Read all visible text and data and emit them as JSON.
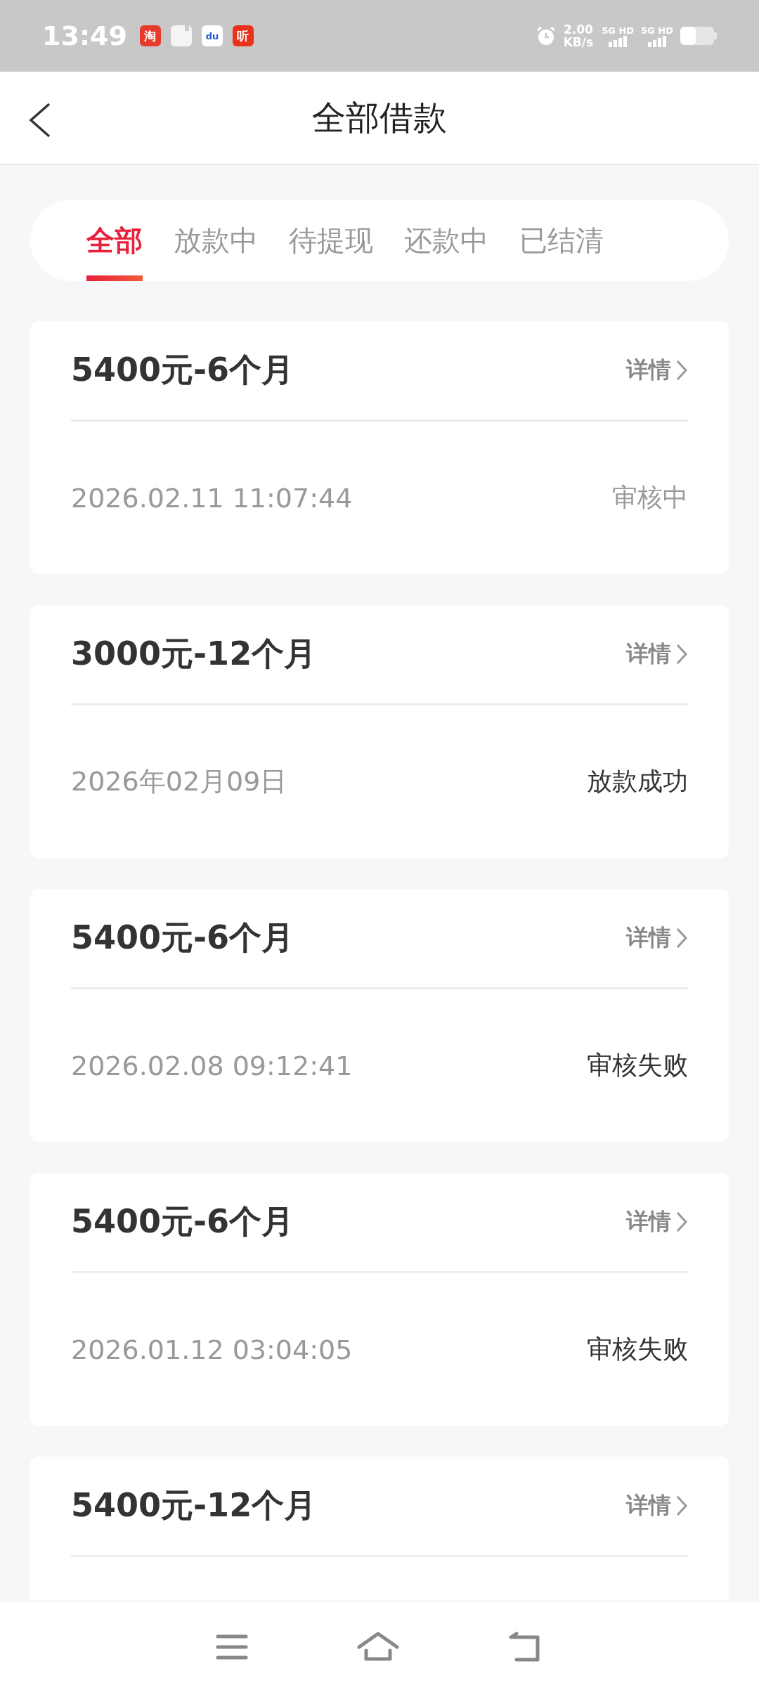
{
  "status_bar": {
    "time": "13:49",
    "speed_value": "2.00",
    "speed_unit": "KB/s",
    "sim_1": "5G HD",
    "sim_2": "5G HD",
    "notification_apps": [
      {
        "kind": "taobao",
        "label": "淘"
      },
      {
        "kind": "cloud"
      },
      {
        "kind": "baidu",
        "label": "du"
      },
      {
        "kind": "listen",
        "label": "听"
      }
    ]
  },
  "header": {
    "title": "全部借款"
  },
  "tabs": [
    {
      "label": "全部",
      "selected": true
    },
    {
      "label": "放款中",
      "selected": false
    },
    {
      "label": "待提现",
      "selected": false
    },
    {
      "label": "还款中",
      "selected": false
    },
    {
      "label": "已结清",
      "selected": false
    }
  ],
  "loans": [
    {
      "title": "5400元-6个月",
      "detail": "详情",
      "date": "2026.02.11 11:07:44",
      "status": "审核中",
      "color": "#999999"
    },
    {
      "title": "3000元-12个月",
      "detail": "详情",
      "date": "2026年02月09日",
      "status": "放款成功",
      "color": "#333333"
    },
    {
      "title": "5400元-6个月",
      "detail": "详情",
      "date": "2026.02.08 09:12:41",
      "status": "审核失败",
      "color": "#333333"
    },
    {
      "title": "5400元-6个月",
      "detail": "详情",
      "date": "2026.01.12 03:04:05",
      "status": "审核失败",
      "color": "#333333"
    },
    {
      "title": "5400元-12个月",
      "detail": "详情"
    }
  ]
}
